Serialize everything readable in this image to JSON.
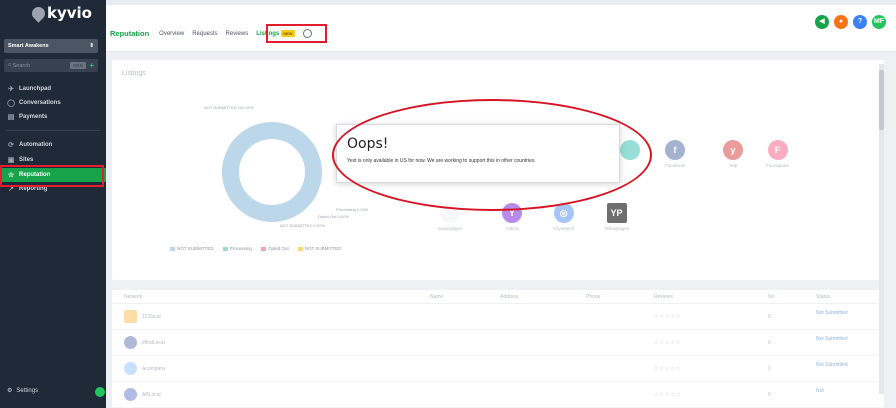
{
  "sidebar": {
    "logo": "kyvio",
    "account": "Smart Awakens",
    "search_placeholder": "Search",
    "search_shortcut": "ctrl K",
    "items": [
      {
        "label": "Launchpad"
      },
      {
        "label": "Conversations"
      },
      {
        "label": "Payments"
      },
      {
        "label": "Automation"
      },
      {
        "label": "Sites"
      },
      {
        "label": "Reputation"
      },
      {
        "label": "Reporting"
      }
    ],
    "settings": "Settings"
  },
  "header": {
    "brand": "Reputation",
    "tabs": [
      "Overview",
      "Requests",
      "Reviews",
      "Listings"
    ],
    "active_tab": "Listings",
    "new_badge": "NEW",
    "avatar_initials": "MF"
  },
  "card": {
    "title": "Listings",
    "donut_labels": {
      "top": "NOT SUBMITTED 100.00%",
      "processing": "Processing 0.00%",
      "opted_out": "Opted Out 0.00%",
      "bottom": "NOT SUBMITTED 0.00%"
    },
    "legend": [
      "NOT SUBMITTED",
      "Processing",
      "Opted Out",
      "NOT SUBMITTED"
    ],
    "directories_row1": [
      "Facebook",
      "Yelp",
      "Foursquare"
    ],
    "directories_row2": [
      "Superpages",
      "Yahoo",
      "Citysearch",
      "Yellowpages"
    ]
  },
  "modal": {
    "title": "Oops!",
    "message": "Yext is only available in US for now. We are working to support this in other countries."
  },
  "table": {
    "headers": [
      "Network",
      "Name",
      "Address",
      "Phone",
      "Reviews",
      "No",
      "Status"
    ],
    "rows": [
      {
        "name": "123local",
        "rating": "☆☆☆☆☆",
        "count": "0",
        "status": "Not Submitted"
      },
      {
        "name": "2findLocal",
        "rating": "☆☆☆☆☆",
        "count": "0",
        "status": "Not Submitted"
      },
      {
        "name": "Acompany",
        "rating": "☆☆☆☆☆",
        "count": "0",
        "status": "Not Submitted"
      },
      {
        "name": "ABLocal",
        "rating": "☆☆☆☆☆",
        "count": "0",
        "status": "Not"
      }
    ]
  },
  "colors": {
    "sidebar_bg": "#1f2937",
    "accent_green": "#16a34a",
    "highlight_red": "#e11d2e",
    "donut_blue": "#bcd6ea"
  }
}
